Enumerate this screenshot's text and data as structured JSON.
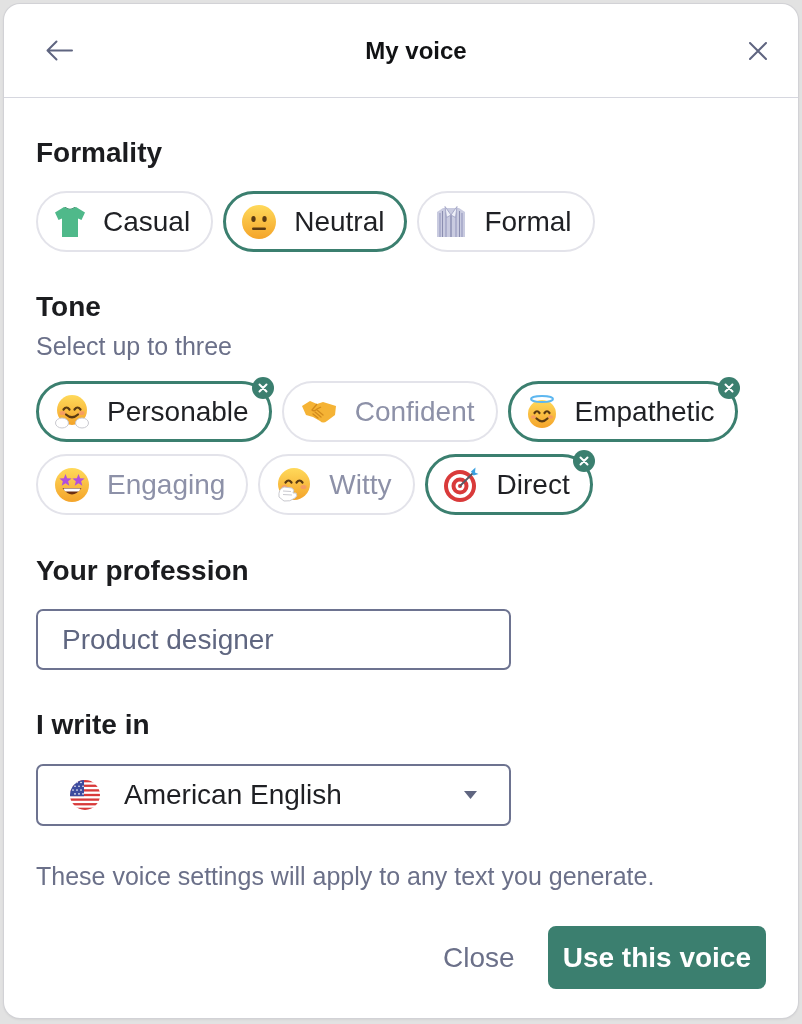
{
  "header": {
    "title": "My voice"
  },
  "formality": {
    "heading": "Formality",
    "options": [
      {
        "label": "Casual",
        "selected": false
      },
      {
        "label": "Neutral",
        "selected": true
      },
      {
        "label": "Formal",
        "selected": false
      }
    ]
  },
  "tone": {
    "heading": "Tone",
    "hint": "Select up to three",
    "options": [
      {
        "label": "Personable",
        "selected": true,
        "disabled": false
      },
      {
        "label": "Confident",
        "selected": false,
        "disabled": true
      },
      {
        "label": "Empathetic",
        "selected": true,
        "disabled": false
      },
      {
        "label": "Engaging",
        "selected": false,
        "disabled": true
      },
      {
        "label": "Witty",
        "selected": false,
        "disabled": true
      },
      {
        "label": "Direct",
        "selected": true,
        "disabled": false
      }
    ]
  },
  "profession": {
    "heading": "Your profession",
    "placeholder": "Product designer"
  },
  "language": {
    "heading": "I write in",
    "value": "American English"
  },
  "note": "These voice settings will apply to any text you generate.",
  "buttons": [
    {
      "label": "Close",
      "kind": "text"
    },
    {
      "label": "Use this voice",
      "kind": "primary"
    }
  ]
}
